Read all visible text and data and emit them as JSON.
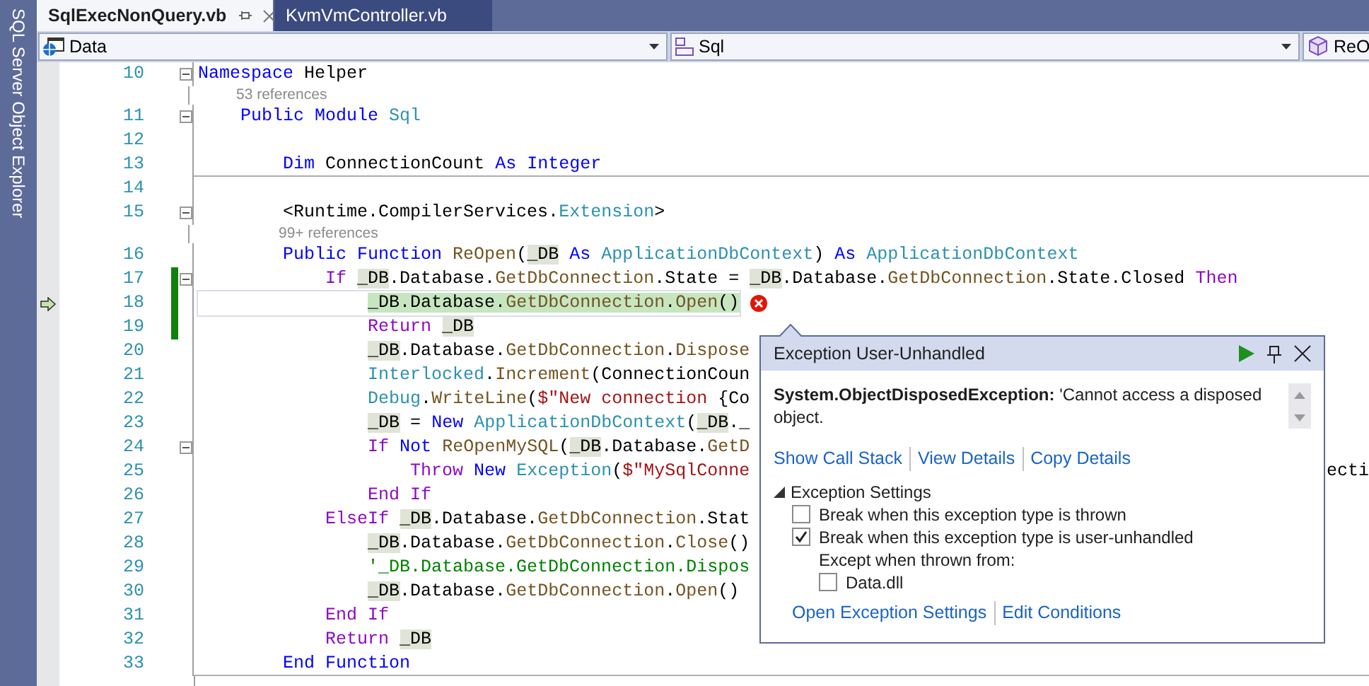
{
  "side_panel": {
    "label": "SQL Server Object Explorer"
  },
  "tabs": [
    {
      "label": "SqlExecNonQuery.vb",
      "selected": true
    },
    {
      "label": "KvmVmController.vb",
      "selected": false
    }
  ],
  "nav_bar": [
    {
      "kind": "project",
      "value": "Data"
    },
    {
      "kind": "class",
      "value": "Sql"
    },
    {
      "kind": "method",
      "value": "ReO"
    }
  ],
  "code_lines": [
    {
      "n": "10",
      "fold": true,
      "changed": false,
      "current": false,
      "error": false,
      "separator": false,
      "code": [
        {
          "kind": "kw",
          "text": "Namespace "
        },
        {
          "kind": "plain",
          "text": "Helper"
        }
      ]
    },
    {
      "refs": "53 references"
    },
    {
      "n": "11",
      "fold": true,
      "changed": false,
      "current": false,
      "error": false,
      "separator": false,
      "code": [
        {
          "kind": "kw",
          "text": "    Public "
        },
        {
          "kind": "kw",
          "text": "Module "
        },
        {
          "kind": "type",
          "text": "Sql"
        }
      ]
    },
    {
      "n": "12",
      "fold": false,
      "changed": false,
      "current": false,
      "error": false,
      "separator": false
    },
    {
      "n": "13",
      "fold": false,
      "changed": false,
      "current": false,
      "error": false,
      "separator": true,
      "code": [
        {
          "kind": "kw",
          "text": "        Dim "
        },
        {
          "kind": "plain",
          "text": "ConnectionCount "
        },
        {
          "kind": "kw",
          "text": "As "
        },
        {
          "kind": "kw",
          "text": "Integer"
        }
      ]
    },
    {
      "n": "14",
      "fold": false,
      "changed": false,
      "current": false,
      "error": false,
      "separator": false
    },
    {
      "n": "15",
      "fold": true,
      "changed": false,
      "current": false,
      "error": false,
      "separator": false,
      "code": [
        {
          "kind": "plain",
          "text": "        <Runtime.CompilerServices."
        },
        {
          "kind": "type",
          "text": "Extension"
        },
        {
          "kind": "plain",
          "text": ">"
        }
      ]
    },
    {
      "refs": "99+ references"
    },
    {
      "n": "16",
      "fold": false,
      "changed": false,
      "current": false,
      "error": false,
      "separator": false,
      "code": [
        {
          "kind": "kw",
          "text": "        Public "
        },
        {
          "kind": "kw",
          "text": "Function "
        },
        {
          "kind": "method",
          "text": "ReOpen"
        },
        {
          "kind": "plain",
          "text": "("
        },
        {
          "kind": "ref",
          "text": "_DB"
        },
        {
          "kind": "kw",
          "text": " As "
        },
        {
          "kind": "type",
          "text": "ApplicationDbContext"
        },
        {
          "kind": "plain",
          "text": ") "
        },
        {
          "kind": "kw",
          "text": "As "
        },
        {
          "kind": "type",
          "text": "ApplicationDbContext"
        }
      ]
    },
    {
      "n": "17",
      "fold": true,
      "changed": true,
      "current": false,
      "error": false,
      "separator": false,
      "code": [
        {
          "kind": "ctl",
          "text": "            If "
        },
        {
          "kind": "ref",
          "text": "_DB"
        },
        {
          "kind": "plain",
          "text": ".Database."
        },
        {
          "kind": "method",
          "text": "GetDbConnection"
        },
        {
          "kind": "plain",
          "text": ".State = "
        },
        {
          "kind": "ref",
          "text": "_DB"
        },
        {
          "kind": "plain",
          "text": ".Database."
        },
        {
          "kind": "method",
          "text": "GetDbConnection"
        },
        {
          "kind": "plain",
          "text": ".State.Closed "
        },
        {
          "kind": "ctl",
          "text": "Then"
        }
      ]
    },
    {
      "n": "18",
      "fold": false,
      "changed": true,
      "current": true,
      "error": true,
      "separator": false,
      "code": [
        {
          "kind": "ref",
          "text": "                _DB"
        },
        {
          "kind": "plain",
          "text": ".Database."
        },
        {
          "kind": "method",
          "text": "GetDbConnection"
        },
        {
          "kind": "plain",
          "text": "."
        },
        {
          "kind": "method",
          "text": "Open"
        },
        {
          "kind": "plain",
          "text": "()"
        }
      ]
    },
    {
      "n": "19",
      "fold": false,
      "changed": true,
      "current": false,
      "error": false,
      "separator": false,
      "code": [
        {
          "kind": "ctl",
          "text": "                Return "
        },
        {
          "kind": "ref",
          "text": "_DB"
        }
      ]
    },
    {
      "n": "20",
      "fold": false,
      "changed": false,
      "current": false,
      "error": false,
      "separator": false,
      "code": [
        {
          "kind": "ref",
          "text": "                _DB"
        },
        {
          "kind": "plain",
          "text": ".Database."
        },
        {
          "kind": "method",
          "text": "GetDbConnection"
        },
        {
          "kind": "plain",
          "text": "."
        },
        {
          "kind": "method",
          "text": "Dispose"
        }
      ]
    },
    {
      "n": "21",
      "fold": false,
      "changed": false,
      "current": false,
      "error": false,
      "separator": false,
      "code": [
        {
          "kind": "type",
          "text": "                Interlocked"
        },
        {
          "kind": "plain",
          "text": "."
        },
        {
          "kind": "method",
          "text": "Increment"
        },
        {
          "kind": "plain",
          "text": "(ConnectionCoun"
        }
      ]
    },
    {
      "n": "22",
      "fold": false,
      "changed": false,
      "current": false,
      "error": false,
      "separator": false,
      "code": [
        {
          "kind": "type",
          "text": "                Debug"
        },
        {
          "kind": "plain",
          "text": "."
        },
        {
          "kind": "method",
          "text": "WriteLine"
        },
        {
          "kind": "plain",
          "text": "("
        },
        {
          "kind": "str",
          "text": "$\"New connection "
        },
        {
          "kind": "plain",
          "text": "{Co"
        }
      ]
    },
    {
      "n": "23",
      "fold": false,
      "changed": false,
      "current": false,
      "error": false,
      "separator": false,
      "code": [
        {
          "kind": "ref",
          "text": "                _DB"
        },
        {
          "kind": "plain",
          "text": " = "
        },
        {
          "kind": "kw",
          "text": "New "
        },
        {
          "kind": "type",
          "text": "ApplicationDbContext"
        },
        {
          "kind": "plain",
          "text": "("
        },
        {
          "kind": "ref",
          "text": "_DB"
        },
        {
          "kind": "plain",
          "text": "._"
        }
      ]
    },
    {
      "n": "24",
      "fold": true,
      "changed": false,
      "current": false,
      "error": false,
      "separator": false,
      "code": [
        {
          "kind": "ctl",
          "text": "                If "
        },
        {
          "kind": "kw",
          "text": "Not "
        },
        {
          "kind": "method",
          "text": "ReOpenMySQL"
        },
        {
          "kind": "plain",
          "text": "("
        },
        {
          "kind": "ref",
          "text": "_DB"
        },
        {
          "kind": "plain",
          "text": ".Database."
        },
        {
          "kind": "method",
          "text": "GetD"
        }
      ]
    },
    {
      "n": "25",
      "fold": false,
      "changed": false,
      "current": false,
      "error": false,
      "separator": false,
      "code": [
        {
          "kind": "ctl",
          "text": "                    Throw "
        },
        {
          "kind": "kw",
          "text": "New "
        },
        {
          "kind": "type",
          "text": "Exception"
        },
        {
          "kind": "plain",
          "text": "("
        },
        {
          "kind": "str",
          "text": "$\"MySqlConne"
        }
      ],
      "tail": "ecti"
    },
    {
      "n": "26",
      "fold": false,
      "changed": false,
      "current": false,
      "error": false,
      "separator": false,
      "code": [
        {
          "kind": "ctl",
          "text": "                End If"
        }
      ]
    },
    {
      "n": "27",
      "fold": false,
      "changed": false,
      "current": false,
      "error": false,
      "separator": false,
      "code": [
        {
          "kind": "ctl",
          "text": "            ElseIf "
        },
        {
          "kind": "ref",
          "text": "_DB"
        },
        {
          "kind": "plain",
          "text": ".Database."
        },
        {
          "kind": "method",
          "text": "GetDbConnection"
        },
        {
          "kind": "plain",
          "text": ".Stat"
        }
      ]
    },
    {
      "n": "28",
      "fold": false,
      "changed": false,
      "current": false,
      "error": false,
      "separator": false,
      "code": [
        {
          "kind": "ref",
          "text": "                _DB"
        },
        {
          "kind": "plain",
          "text": ".Database."
        },
        {
          "kind": "method",
          "text": "GetDbConnection"
        },
        {
          "kind": "plain",
          "text": "."
        },
        {
          "kind": "method",
          "text": "Close"
        },
        {
          "kind": "plain",
          "text": "()"
        }
      ]
    },
    {
      "n": "29",
      "fold": false,
      "changed": false,
      "current": false,
      "error": false,
      "separator": false,
      "code": [
        {
          "kind": "com",
          "text": "                '_DB.Database.GetDbConnection.Dispos"
        }
      ]
    },
    {
      "n": "30",
      "fold": false,
      "changed": false,
      "current": false,
      "error": false,
      "separator": false,
      "code": [
        {
          "kind": "ref",
          "text": "                _DB"
        },
        {
          "kind": "plain",
          "text": ".Database."
        },
        {
          "kind": "method",
          "text": "GetDbConnection"
        },
        {
          "kind": "plain",
          "text": "."
        },
        {
          "kind": "method",
          "text": "Open"
        },
        {
          "kind": "plain",
          "text": "()"
        }
      ]
    },
    {
      "n": "31",
      "fold": false,
      "changed": false,
      "current": false,
      "error": false,
      "separator": false,
      "code": [
        {
          "kind": "ctl",
          "text": "            End If"
        }
      ]
    },
    {
      "n": "32",
      "fold": false,
      "changed": false,
      "current": false,
      "error": false,
      "separator": false,
      "code": [
        {
          "kind": "ctl",
          "text": "            Return "
        },
        {
          "kind": "ref",
          "text": "_DB"
        }
      ]
    },
    {
      "n": "33",
      "fold": false,
      "changed": false,
      "current": false,
      "error": false,
      "separator": true,
      "code": [
        {
          "kind": "kw",
          "text": "        End "
        },
        {
          "kind": "kw",
          "text": "Function"
        }
      ]
    }
  ],
  "exception_popup": {
    "title": "Exception User-Unhandled",
    "message": "**System.ObjectDisposedException:** 'Cannot access a disposed object.",
    "links": [
      "Show Call Stack",
      "View Details",
      "Copy Details"
    ],
    "settings": {
      "label": "Exception Settings",
      "expanded": true,
      "options": [
        {
          "label": "Break when this exception type is thrown",
          "checked": false
        },
        {
          "label": "Break when this exception type is user-unhandled",
          "checked": true
        }
      ],
      "except_label": "Except when thrown from:",
      "modules": [
        {
          "label": "Data.dll",
          "checked": false
        }
      ]
    },
    "footer_links": [
      "Open Exception Settings",
      "Edit Conditions"
    ]
  }
}
